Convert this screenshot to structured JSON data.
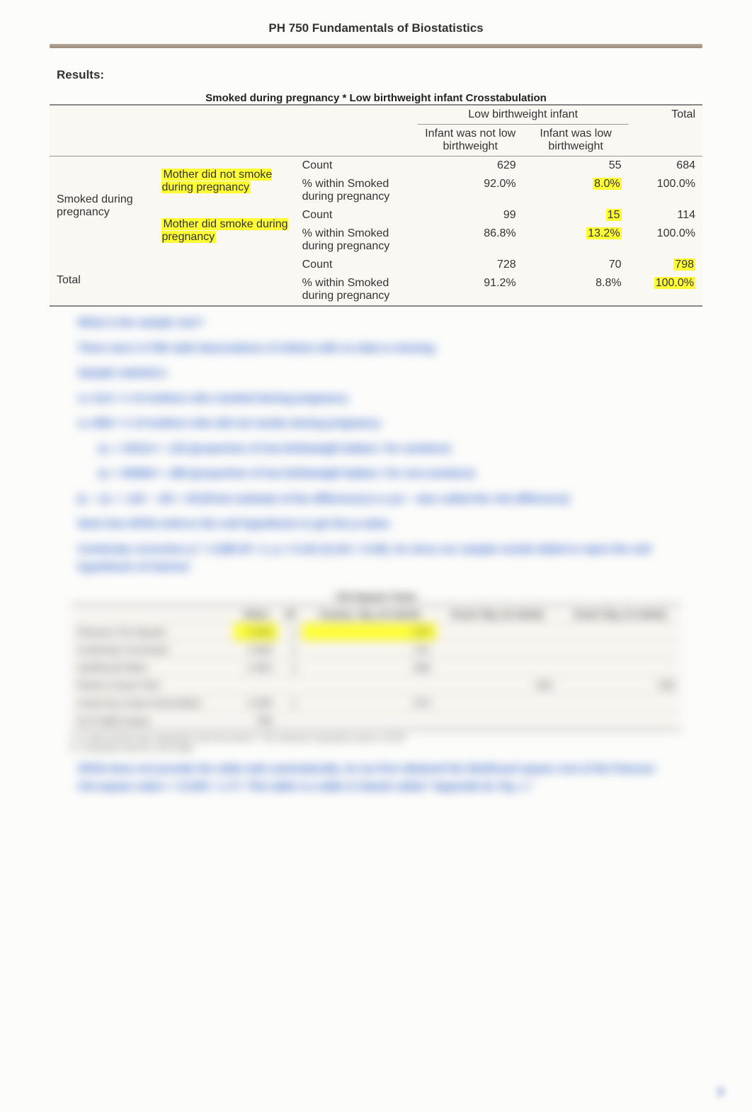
{
  "header": {
    "course_title": "PH 750 Fundamentals of Biostatistics"
  },
  "results_label": "Results:",
  "crosstab": {
    "title": "Smoked during pregnancy * Low birthweight infant Crosstabulation",
    "col_group": "Low birthweight infant",
    "col_total": "Total",
    "col1": "Infant was not low birthweight",
    "col2": "Infant was low birthweight",
    "row_group_label": "Smoked during pregnancy",
    "row1_label": "Mother did not smoke during pregnancy",
    "row2_label": "Mother did smoke during pregnancy",
    "row_total_label": "Total",
    "stat_count": "Count",
    "stat_pct": "% within Smoked during pregnancy",
    "r1": {
      "count": [
        "629",
        "55",
        "684"
      ],
      "pct": [
        "92.0%",
        "8.0%",
        "100.0%"
      ]
    },
    "r2": {
      "count": [
        "99",
        "15",
        "114"
      ],
      "pct": [
        "86.8%",
        "13.2%",
        "100.0%"
      ]
    },
    "rt": {
      "count": [
        "728",
        "70",
        "798"
      ],
      "pct": [
        "91.2%",
        "8.8%",
        "100.0%"
      ]
    }
  },
  "narrative": {
    "q1": "What is the sample size?",
    "a1": "There were n=798 valid observations of infants with no data is missing.",
    "q2": "Sample statistics:",
    "a2a": "n₁=114 = # of mothers who smoked during pregnancy",
    "a2b": "n₂=684 = # of mothers who did not smoke during pregnancy",
    "p1": "p̂₁ = 15/114 = .132  (proportion of low birthweight babies / for smokers)",
    "p2": "p̂₂ = 55/684 = .080  (proportion of low birthweight babies / for non-smokers)",
    "diff": "p̂₁ − p̂₂ = .132 − .08 = .05  [Point estimate of the difference] or a p1 ~ also called the risk difference]",
    "note1": "Note how SPSS enforce the null hypothesis to get the p-value.",
    "note2": "Continuity correction χ² = 2.689  df = 1, p = 0.101  (0.101 > 0.05). So since our sample results failed to reject the null hypothesis of interest.",
    "chi_note": "SPSS does not provide the odds-ratio automatically.  So we first obtained the likelihood square root of the Pearson Chi-square value =  √3.293  = 1.77. This table is a table in Daniel called “Appendix B, Fig. 1.”"
  },
  "chisq_table": {
    "title": "Chi-Square Tests",
    "headers": [
      "",
      "Value",
      "df",
      "Asymp. Sig. (2-sided)",
      "Exact Sig. (2-sided)",
      "Exact Sig. (1-sided)"
    ],
    "rows": [
      {
        "label": "Pearson Chi-Square",
        "value": "3.293",
        "df": "1",
        "asymp": ".070",
        "ex2": "",
        "ex1": ""
      },
      {
        "label": "Continuity Correction",
        "value": "2.689",
        "df": "1",
        "asymp": ".101",
        "ex2": "",
        "ex1": ""
      },
      {
        "label": "Likelihood Ratio",
        "value": "2.950",
        "df": "1",
        "asymp": ".086",
        "ex2": "",
        "ex1": ""
      },
      {
        "label": "Fisher's Exact Test",
        "value": "",
        "df": "",
        "asymp": "",
        "ex2": ".081",
        "ex1": ".055"
      },
      {
        "label": "Linear-by-Linear Association",
        "value": "3.289",
        "df": "1",
        "asymp": ".070",
        "ex2": "",
        "ex1": ""
      },
      {
        "label": "N of Valid Cases",
        "value": "798",
        "df": "",
        "asymp": "",
        "ex2": "",
        "ex1": ""
      }
    ],
    "footnote_a": "a. 0 cells (0.0%) have expected count less than 5. The minimum expected count is 10.00.",
    "footnote_b": "b. Computed only for a 2x2 table"
  },
  "page_number": "2"
}
